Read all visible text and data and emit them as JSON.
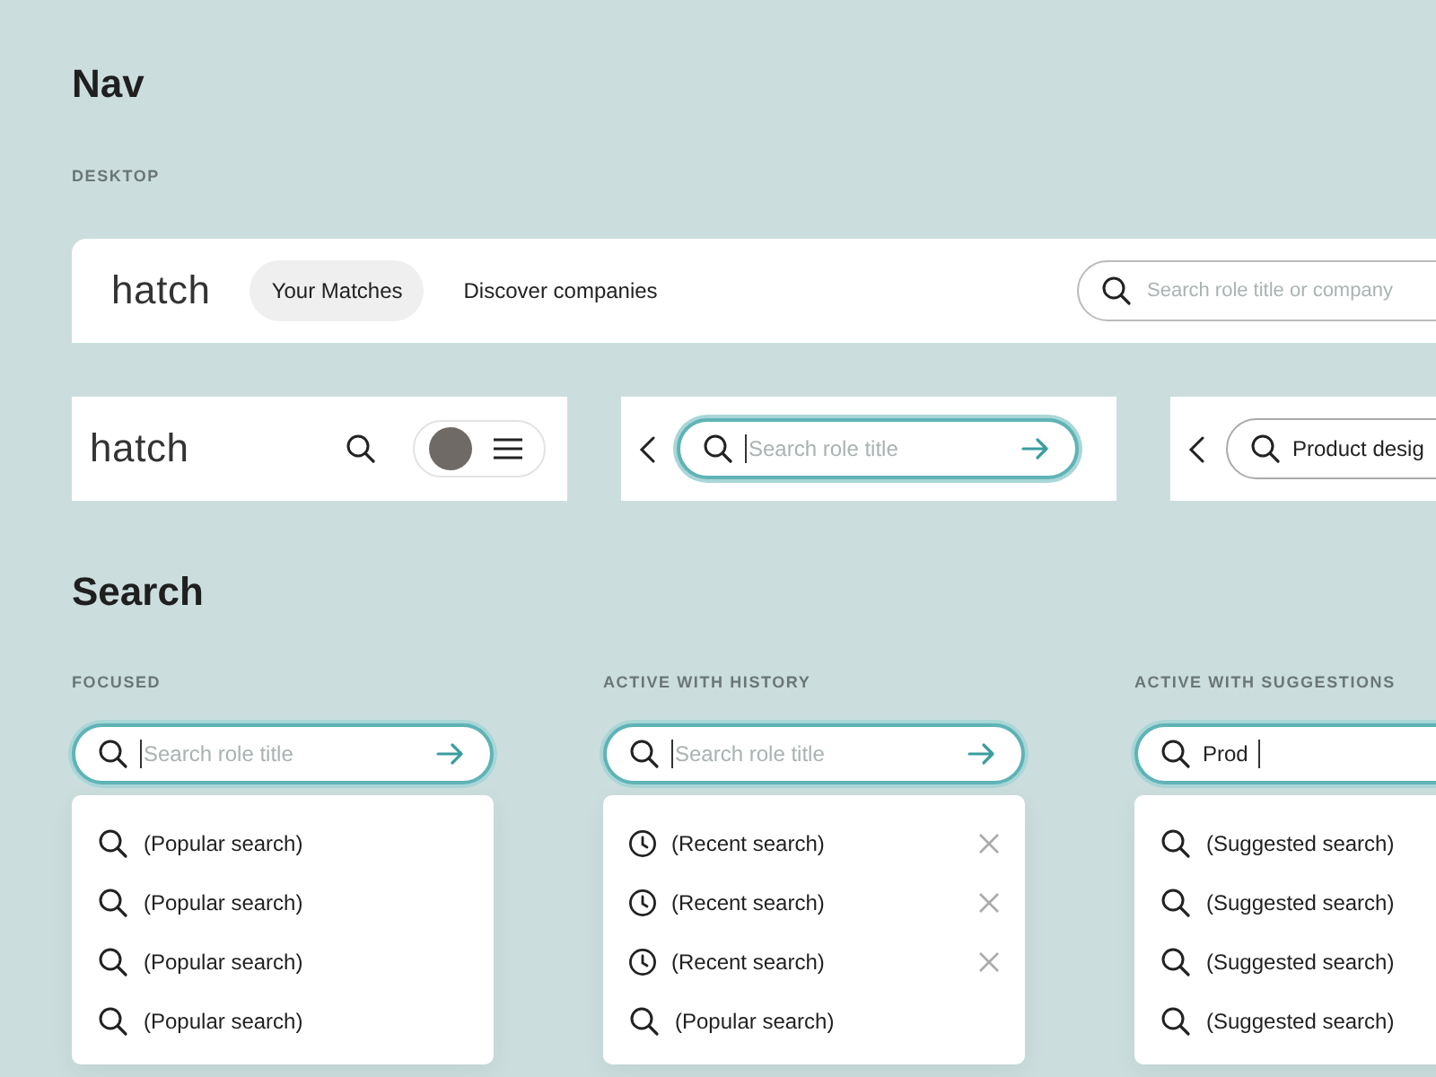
{
  "nav": {
    "title": "Nav",
    "section_label": "DESKTOP",
    "desktop": {
      "logo": "hatch",
      "tabs": [
        {
          "label": "Your Matches",
          "selected": true
        },
        {
          "label": "Discover companies",
          "selected": false
        }
      ],
      "search": {
        "placeholder": "Search role title or company"
      }
    },
    "mobile": [
      {
        "kind": "home",
        "logo": "hatch"
      },
      {
        "kind": "search",
        "placeholder": "Search role title",
        "focused": true
      },
      {
        "kind": "query",
        "value": "Product desig",
        "focused": false
      }
    ]
  },
  "search": {
    "title": "Search",
    "variants": [
      {
        "label": "FOCUSED",
        "input": {
          "placeholder": "Search role title",
          "focused": true
        },
        "items": [
          {
            "kind": "popular",
            "text": "(Popular search)"
          },
          {
            "kind": "popular",
            "text": "(Popular search)"
          },
          {
            "kind": "popular",
            "text": "(Popular search)"
          },
          {
            "kind": "popular",
            "text": "(Popular search)"
          }
        ]
      },
      {
        "label": "ACTIVE WITH HISTORY",
        "input": {
          "placeholder": "Search role title",
          "focused": true
        },
        "items": [
          {
            "kind": "recent",
            "text": "(Recent search)"
          },
          {
            "kind": "recent",
            "text": "(Recent search)"
          },
          {
            "kind": "recent",
            "text": "(Recent search)"
          },
          {
            "kind": "popular",
            "text": "(Popular search)"
          }
        ]
      },
      {
        "label": "ACTIVE WITH SUGGESTIONS",
        "input": {
          "value": "Prod",
          "focused": true
        },
        "items": [
          {
            "kind": "popular",
            "text": "(Suggested search)"
          },
          {
            "kind": "popular",
            "text": "(Suggested search)"
          },
          {
            "kind": "popular",
            "text": "(Suggested search)"
          },
          {
            "kind": "popular",
            "text": "(Suggested search)"
          }
        ]
      }
    ]
  }
}
